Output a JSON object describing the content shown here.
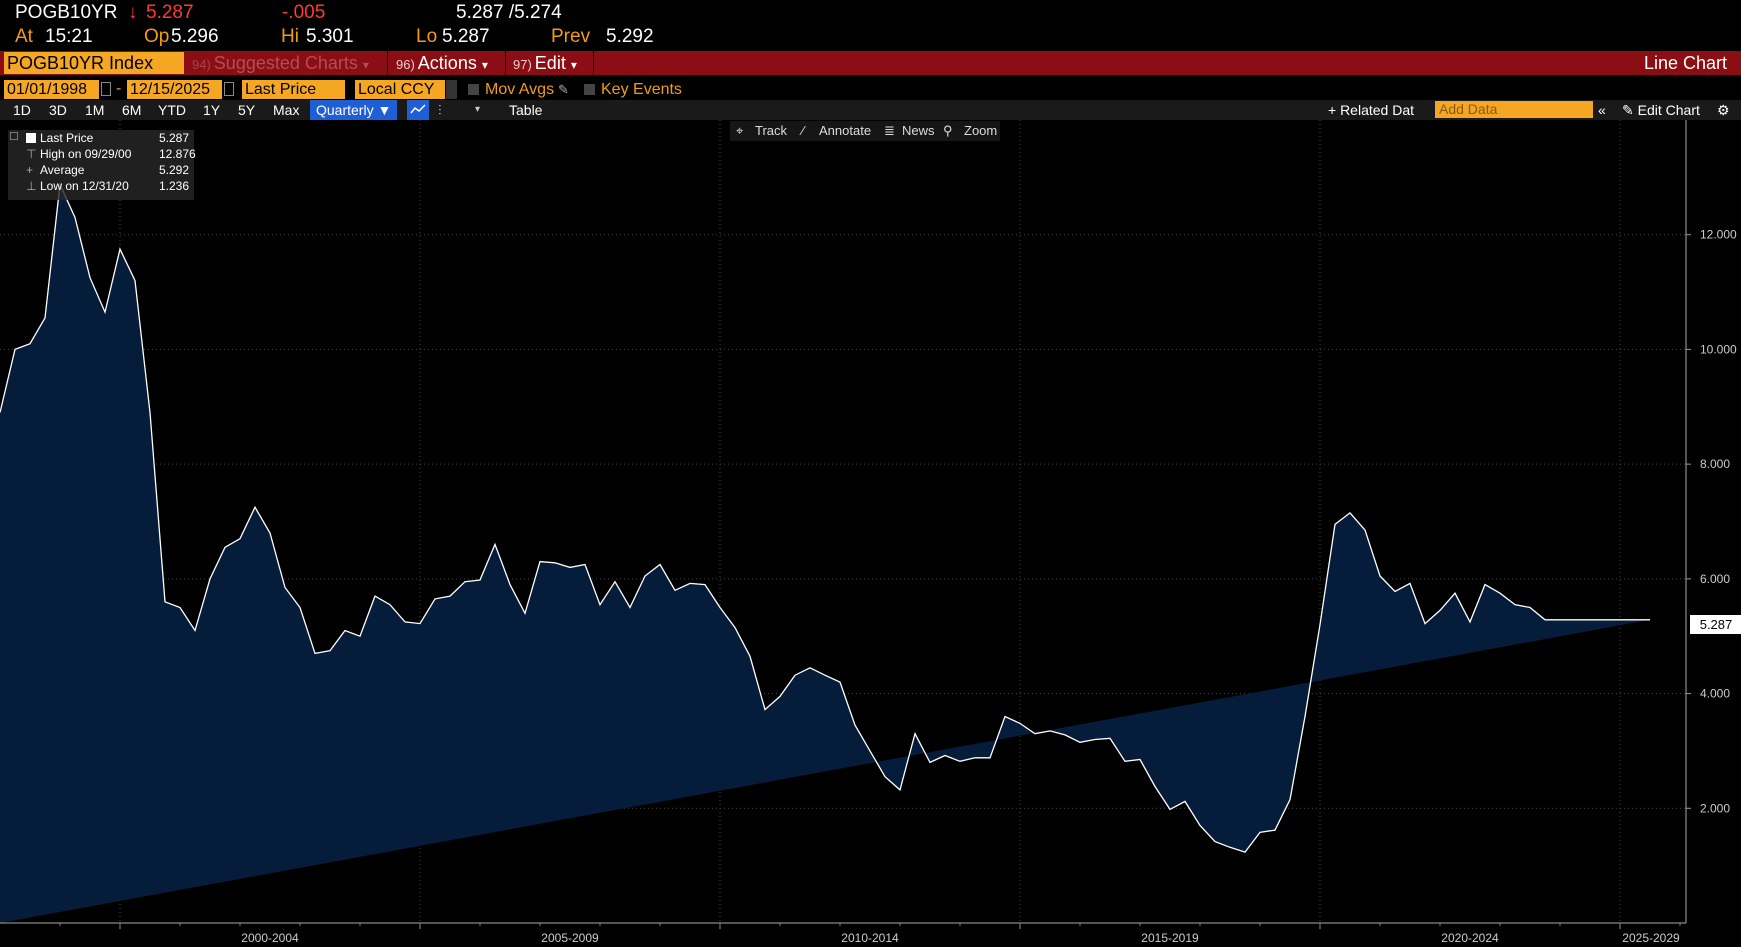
{
  "quote": {
    "ticker": "POGB10YR",
    "arrow": "↓",
    "last": "5.287",
    "change": "-.005",
    "bid_ask": "5.287 /5.274",
    "at_label": "At",
    "time": "15:21",
    "op_label": "Op",
    "open": "5.296",
    "hi_label": "Hi",
    "high": "5.301",
    "lo_label": "Lo",
    "low": "5.287",
    "prev_label": "Prev",
    "prev": "5.292"
  },
  "command_bar": {
    "security": "POGB10YR Index",
    "suggested_num": "94)",
    "suggested": "Suggested Charts",
    "actions_num": "96)",
    "actions": "Actions",
    "edit_num": "97)",
    "edit": "Edit",
    "dropdown_caret": "▾",
    "view_title": "Line Chart"
  },
  "options": {
    "start_date": "01/01/1998",
    "dash": "-",
    "end_date": "12/15/2025",
    "field": "Last Price",
    "currency": "Local CCY",
    "mov_avgs": "Mov Avgs",
    "key_events": "Key Events"
  },
  "range_bar": {
    "ranges": [
      "1D",
      "3D",
      "1M",
      "6M",
      "YTD",
      "1Y",
      "5Y",
      "Max"
    ],
    "frequency": "Quarterly",
    "table": "Table",
    "related": "+ Related Dat",
    "add_data_placeholder": "Add Data",
    "edit_chart": "Edit Chart"
  },
  "chart_toolbar": {
    "track": "Track",
    "annotate": "Annotate",
    "news": "News",
    "zoom": "Zoom"
  },
  "legend": {
    "last_label": "Last Price",
    "last_value": "5.287",
    "high_label": "High on 09/29/00",
    "high_value": "12.876",
    "avg_label": "Average",
    "avg_value": "5.292",
    "low_label": "Low on 12/31/20",
    "low_value": "1.236"
  },
  "colors": {
    "background": "#000000",
    "area_fill": "#051d3a",
    "line": "#ffffff",
    "grid": "#444444",
    "accent_orange": "#f5a623",
    "command_red": "#8b0e14",
    "down_red": "#ff3b30"
  },
  "chart_data": {
    "type": "area",
    "frequency": "Quarterly",
    "ylim": [
      0,
      14
    ],
    "yticks": [
      2,
      4,
      6,
      8,
      10,
      12
    ],
    "ytick_labels": [
      "2.000",
      "4.000",
      "6.000",
      "8.000",
      "10.000",
      "12.000"
    ],
    "xlim": [
      1998.0,
      2026.1
    ],
    "xtick_labels": [
      "2000-2004",
      "2005-2009",
      "2010-2014",
      "2015-2019",
      "2020-2024",
      "2025-2029"
    ],
    "xtick_positions": [
      2002.5,
      2007.5,
      2012.5,
      2017.5,
      2022.5,
      2027.5
    ],
    "last_value_label": "5.287",
    "x": [
      1998.0,
      1998.25,
      1998.5,
      1998.75,
      1999.0,
      1999.25,
      1999.5,
      1999.75,
      2000.0,
      2000.25,
      2000.5,
      2000.75,
      2001.0,
      2001.25,
      2001.5,
      2001.75,
      2002.0,
      2002.25,
      2002.5,
      2002.75,
      2003.0,
      2003.25,
      2003.5,
      2003.75,
      2004.0,
      2004.25,
      2004.5,
      2004.75,
      2005.0,
      2005.25,
      2005.5,
      2005.75,
      2006.0,
      2006.25,
      2006.5,
      2006.75,
      2007.0,
      2007.25,
      2007.5,
      2007.75,
      2008.0,
      2008.25,
      2008.5,
      2008.75,
      2009.0,
      2009.25,
      2009.5,
      2009.75,
      2010.0,
      2010.25,
      2010.5,
      2010.75,
      2011.0,
      2011.25,
      2011.5,
      2011.75,
      2012.0,
      2012.25,
      2012.5,
      2012.75,
      2013.0,
      2013.25,
      2013.5,
      2013.75,
      2014.0,
      2014.25,
      2014.5,
      2014.75,
      2015.0,
      2015.25,
      2015.5,
      2015.75,
      2016.0,
      2016.25,
      2016.5,
      2016.75,
      2017.0,
      2017.25,
      2017.5,
      2017.75,
      2018.0,
      2018.25,
      2018.5,
      2018.75,
      2019.0,
      2019.25,
      2019.5,
      2019.75,
      2020.0,
      2020.25,
      2020.5,
      2020.75,
      2021.0,
      2021.25,
      2021.5,
      2021.75,
      2022.0,
      2022.25,
      2022.5,
      2022.75,
      2023.0,
      2023.25,
      2023.5,
      2023.75,
      2024.0,
      2024.25,
      2024.5,
      2024.75,
      2025.0,
      2025.25,
      2025.5,
      2025.75,
      2025.95
    ],
    "values": [
      8.9,
      10.0,
      10.1,
      10.55,
      12.876,
      12.3,
      11.25,
      10.65,
      11.75,
      11.2,
      8.9,
      5.6,
      5.5,
      5.1,
      6.0,
      6.55,
      6.7,
      7.25,
      6.8,
      5.85,
      5.5,
      4.7,
      4.75,
      5.1,
      5.0,
      5.7,
      5.55,
      5.25,
      5.22,
      5.65,
      5.7,
      5.95,
      5.98,
      6.6,
      5.9,
      5.4,
      6.3,
      6.28,
      6.2,
      6.25,
      5.55,
      5.95,
      5.5,
      6.05,
      6.25,
      5.8,
      5.92,
      5.9,
      5.5,
      5.15,
      4.65,
      3.72,
      3.95,
      4.32,
      4.45,
      4.32,
      4.2,
      3.45,
      3.0,
      2.55,
      2.32,
      3.3,
      2.8,
      2.92,
      2.82,
      2.88,
      2.88,
      3.6,
      3.48,
      3.3,
      3.35,
      3.28,
      3.15,
      3.2,
      3.22,
      2.82,
      2.85,
      2.38,
      1.98,
      2.12,
      1.7,
      1.42,
      1.32,
      1.236,
      1.58,
      1.62,
      2.15,
      3.6,
      5.2,
      6.95,
      7.15,
      6.85,
      6.05,
      5.78,
      5.92,
      5.22,
      5.45,
      5.75,
      5.25,
      5.9,
      5.75,
      5.55,
      5.5,
      5.287,
      5.287,
      5.287,
      5.287,
      5.287,
      5.287,
      5.287,
      5.287
    ],
    "highlight_last": "5.287"
  }
}
